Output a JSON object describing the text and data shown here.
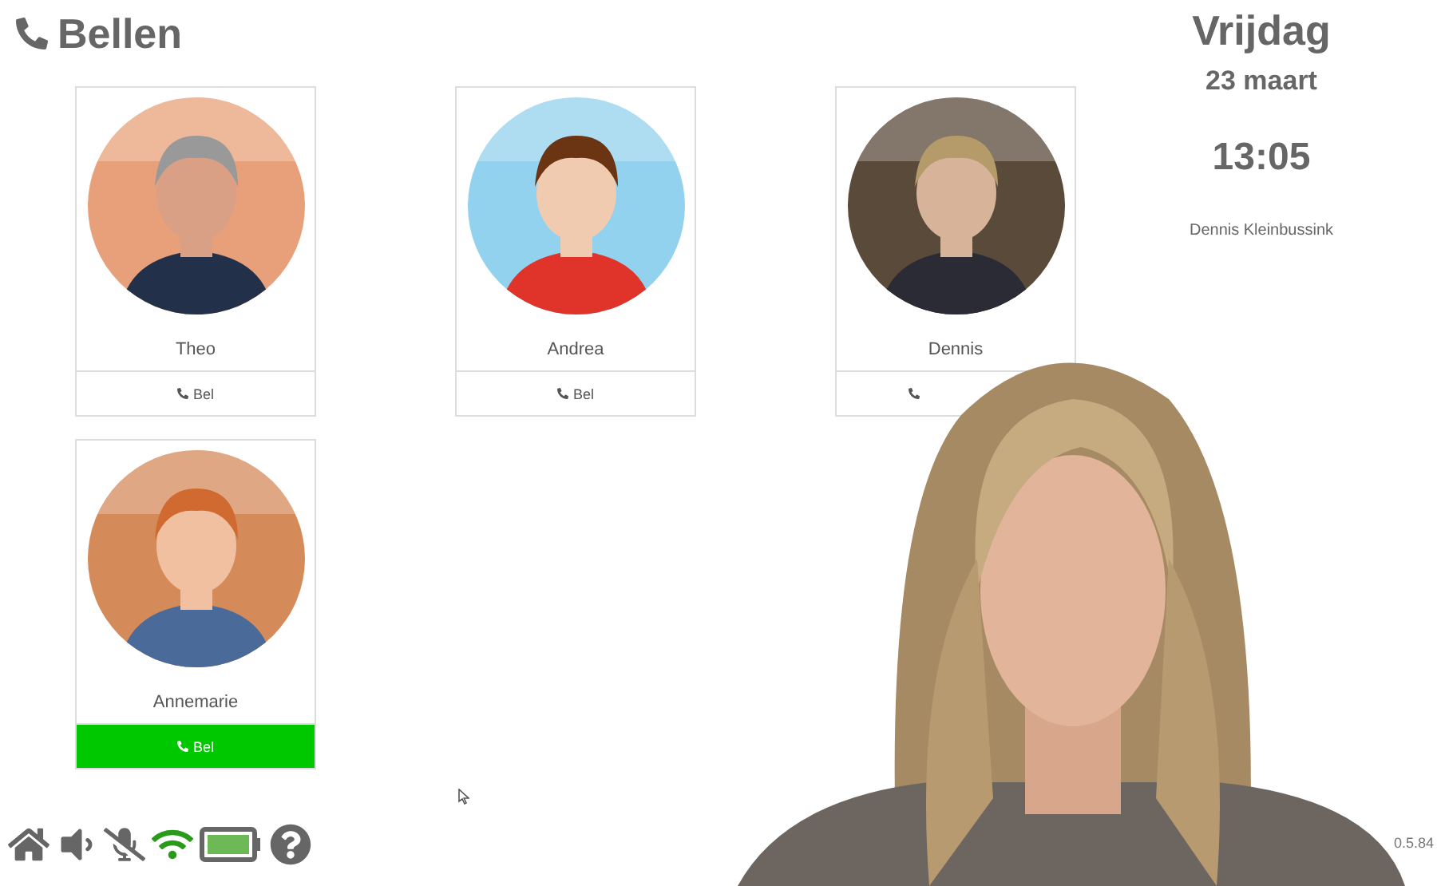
{
  "header": {
    "title": "Bellen"
  },
  "contacts": [
    {
      "name": "Theo",
      "call_label": "Bel",
      "selected": false
    },
    {
      "name": "Andrea",
      "call_label": "Bel",
      "selected": false
    },
    {
      "name": "Dennis",
      "selected": false
    },
    {
      "name": "Annemarie",
      "call_label": "Bel",
      "selected": true
    }
  ],
  "clock": {
    "day": "Vrijdag",
    "date": "23 maart",
    "time": "13:05",
    "user": "Dennis Kleinbussink"
  },
  "status_icons": {
    "microphone_muted": true
  },
  "version": "0.5.84"
}
